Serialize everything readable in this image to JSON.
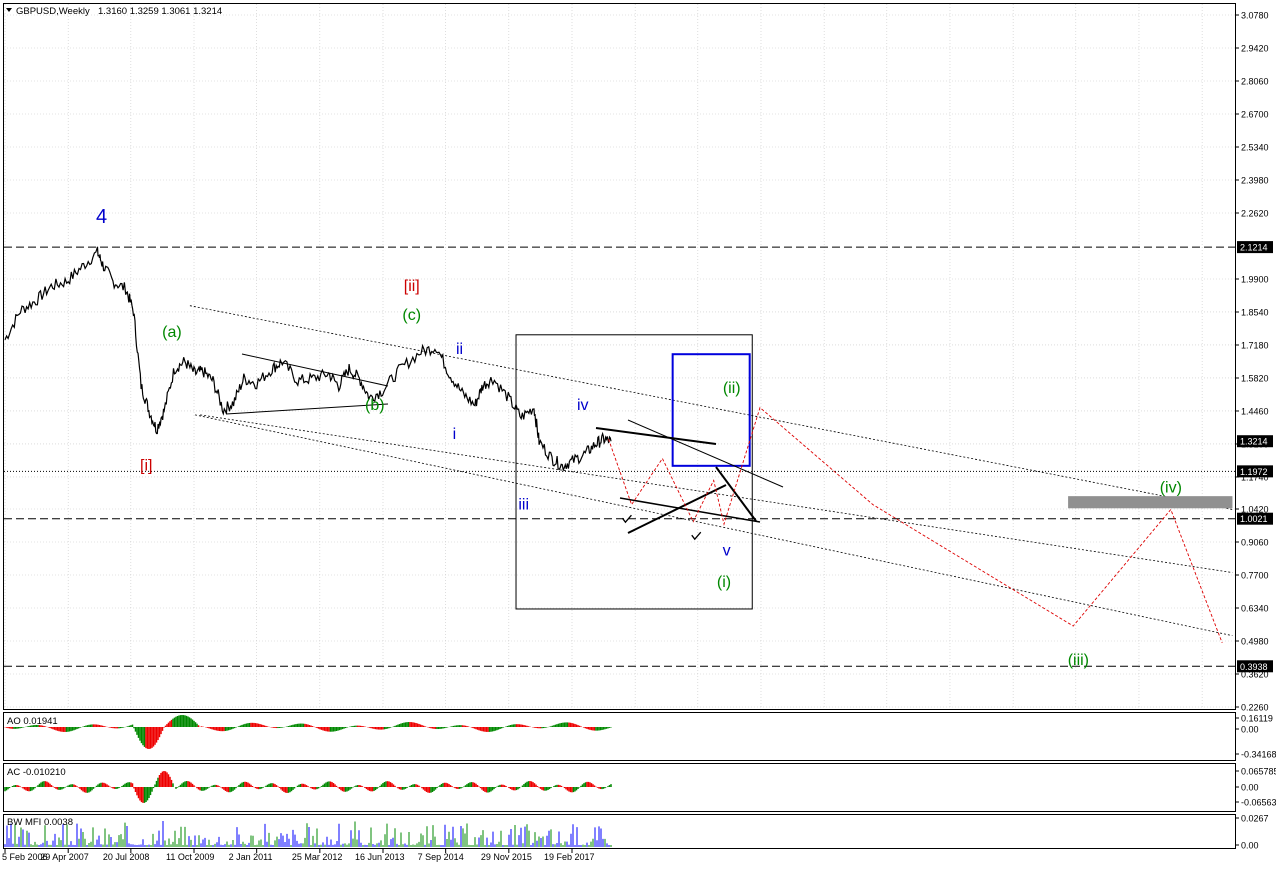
{
  "window": {
    "title": "GBPUSD,Weekly",
    "ohlc": "1.3160 1.3259 1.3061 1.3214",
    "menu_arrow_icon": "triangle-down-icon"
  },
  "chart_data": [
    {
      "type": "line",
      "symbol": "GBPUSD",
      "timeframe": "Weekly",
      "price_axis_ticks": [
        "3.0780",
        "2.9420",
        "2.8060",
        "2.6700",
        "2.5340",
        "2.3980",
        "2.2620",
        "1.9900",
        "1.8540",
        "1.7180",
        "1.5820",
        "1.4460",
        "1.3100",
        "1.1740",
        "1.0420",
        "0.9060",
        "0.7700",
        "0.6340",
        "0.4980",
        "0.3620",
        "0.2260"
      ],
      "ylim": [
        0.226,
        3.078
      ],
      "date_axis_ticks": [
        "5 Feb 2006",
        "29 Apr 2007",
        "20 Jul 2008",
        "11 Oct 2009",
        "2 Jan 2011",
        "25 Mar 2012",
        "16 Jun 2013",
        "7 Sep 2014",
        "29 Nov 2015",
        "19 Feb 2017"
      ],
      "price_badges": [
        {
          "label": "2.1214",
          "value": 2.1214,
          "color": "#000000"
        },
        {
          "label": "1.3214",
          "value": 1.3214,
          "color": "#000000"
        },
        {
          "label": "1.1972",
          "value": 1.1972,
          "color": "#000000"
        },
        {
          "label": "1.0021",
          "value": 1.0021,
          "color": "#000000"
        },
        {
          "label": "0.3938",
          "value": 0.3938,
          "color": "#000000"
        }
      ],
      "horizontal_levels": [
        {
          "value": 2.1214,
          "style": "dashed"
        },
        {
          "value": 1.1972,
          "style": "dotted"
        },
        {
          "value": 1.0021,
          "style": "dashed"
        },
        {
          "value": 0.3938,
          "style": "dashed"
        }
      ],
      "price_series": [
        [
          2006.1,
          1.74
        ],
        [
          2006.4,
          1.86
        ],
        [
          2006.7,
          1.9
        ],
        [
          2007.0,
          1.96
        ],
        [
          2007.3,
          1.98
        ],
        [
          2007.6,
          2.04
        ],
        [
          2007.9,
          2.1
        ],
        [
          2008.0,
          2.05
        ],
        [
          2008.2,
          1.98
        ],
        [
          2008.45,
          1.95
        ],
        [
          2008.6,
          1.86
        ],
        [
          2008.75,
          1.55
        ],
        [
          2008.9,
          1.45
        ],
        [
          2009.05,
          1.37
        ],
        [
          2009.2,
          1.45
        ],
        [
          2009.4,
          1.62
        ],
        [
          2009.6,
          1.65
        ],
        [
          2009.8,
          1.6
        ],
        [
          2009.95,
          1.61
        ],
        [
          2010.15,
          1.57
        ],
        [
          2010.35,
          1.45
        ],
        [
          2010.55,
          1.48
        ],
        [
          2010.75,
          1.58
        ],
        [
          2011.0,
          1.56
        ],
        [
          2011.3,
          1.62
        ],
        [
          2011.5,
          1.65
        ],
        [
          2011.8,
          1.57
        ],
        [
          2012.1,
          1.58
        ],
        [
          2012.4,
          1.6
        ],
        [
          2012.6,
          1.55
        ],
        [
          2012.8,
          1.62
        ],
        [
          2013.0,
          1.58
        ],
        [
          2013.2,
          1.5
        ],
        [
          2013.45,
          1.53
        ],
        [
          2013.8,
          1.62
        ],
        [
          2014.2,
          1.69
        ],
        [
          2014.5,
          1.71
        ],
        [
          2014.75,
          1.6
        ],
        [
          2015.0,
          1.52
        ],
        [
          2015.25,
          1.47
        ],
        [
          2015.4,
          1.55
        ],
        [
          2015.6,
          1.58
        ],
        [
          2015.9,
          1.5
        ],
        [
          2016.15,
          1.42
        ],
        [
          2016.4,
          1.46
        ],
        [
          2016.5,
          1.32
        ],
        [
          2016.75,
          1.25
        ],
        [
          2016.95,
          1.22
        ],
        [
          2017.15,
          1.24
        ],
        [
          2017.4,
          1.27
        ],
        [
          2017.6,
          1.31
        ],
        [
          2017.75,
          1.33
        ],
        [
          2017.9,
          1.3214
        ]
      ],
      "wave_labels": [
        {
          "text": "4",
          "color": "#0000cc",
          "year": 2007.98,
          "price": 2.22
        },
        {
          "text": "(a)",
          "color": "#008800",
          "year": 2009.35,
          "price": 1.75
        },
        {
          "text": "[i]",
          "color": "#cc0000",
          "year": 2008.85,
          "price": 1.2
        },
        {
          "text": "(b)",
          "color": "#008800",
          "year": 2013.3,
          "price": 1.45
        },
        {
          "text": "[ii]",
          "color": "#cc0000",
          "year": 2014.02,
          "price": 1.94
        },
        {
          "text": "(c)",
          "color": "#008800",
          "year": 2014.02,
          "price": 1.82
        },
        {
          "text": "ii",
          "color": "#0000cc",
          "year": 2014.95,
          "price": 1.68
        },
        {
          "text": "i",
          "color": "#0000cc",
          "year": 2014.85,
          "price": 1.33
        },
        {
          "text": "iii",
          "color": "#0000cc",
          "year": 2016.2,
          "price": 1.04
        },
        {
          "text": "iv",
          "color": "#0000cc",
          "year": 2017.35,
          "price": 1.45
        },
        {
          "text": "v",
          "color": "#0000cc",
          "year": 2020.15,
          "price": 0.85
        },
        {
          "text": "(i)",
          "color": "#008800",
          "year": 2020.1,
          "price": 0.72
        },
        {
          "text": "(ii)",
          "color": "#008800",
          "year": 2020.25,
          "price": 1.52
        },
        {
          "text": "(iii)",
          "color": "#008800",
          "year": 2027.0,
          "price": 0.4
        },
        {
          "text": "(iv)",
          "color": "#008800",
          "year": 2028.8,
          "price": 1.11
        }
      ],
      "projection_red": [
        [
          2017.85,
          1.33
        ],
        [
          2018.3,
          1.06
        ],
        [
          2018.9,
          1.25
        ],
        [
          2019.5,
          0.99
        ],
        [
          2019.9,
          1.16
        ],
        [
          2020.1,
          0.98
        ],
        [
          2020.45,
          1.22
        ],
        [
          2020.8,
          1.46
        ],
        [
          2023.0,
          1.06
        ],
        [
          2026.9,
          0.56
        ],
        [
          2028.8,
          1.04
        ],
        [
          2029.8,
          0.49
        ]
      ],
      "channel_dotted": [
        {
          "from": [
            2009.7,
            1.88
          ],
          "to": [
            2030.0,
            1.04
          ]
        },
        {
          "from": [
            2009.9,
            1.43
          ],
          "to": [
            2030.0,
            0.78
          ]
        },
        {
          "from": [
            2009.8,
            1.43
          ],
          "to": [
            2030.0,
            0.52
          ]
        }
      ],
      "boxes": [
        {
          "name": "black-box",
          "x1": 2016.05,
          "y1": 1.76,
          "x2": 2020.65,
          "y2": 0.63,
          "color": "#000000"
        },
        {
          "name": "blue-box",
          "x1": 2019.1,
          "y1": 1.68,
          "x2": 2020.6,
          "y2": 1.22,
          "color": "#0000dd"
        },
        {
          "name": "grey-zone",
          "x1": 2026.8,
          "y1": 1.095,
          "x2": 2030.0,
          "y2": 1.045,
          "color": "#909090"
        }
      ],
      "checkmarks": [
        [
          2018.2,
          1.0
        ],
        [
          2019.55,
          0.93
        ]
      ]
    },
    {
      "type": "bar",
      "name": "AO",
      "label": "AO 0.01941",
      "ticks": [
        "0.16119",
        "0.00",
        "-0.34168"
      ],
      "ylim": [
        -0.4,
        0.22
      ]
    },
    {
      "type": "bar",
      "name": "AC",
      "label": "AC -0.010210",
      "ticks": [
        "0.065785",
        "0.00",
        "-0.065636"
      ],
      "ylim": [
        -0.085,
        0.085
      ]
    },
    {
      "type": "bar",
      "name": "BW MFI",
      "label": "BW MFI 0.0038",
      "ticks": [
        "0.0267",
        "0.00"
      ],
      "ylim": [
        0,
        0.03
      ]
    }
  ],
  "colors": {
    "up_bar": "#008800",
    "down_bar": "#ee0000",
    "projection": "#dd0000",
    "grid": "#c8c8c8"
  }
}
